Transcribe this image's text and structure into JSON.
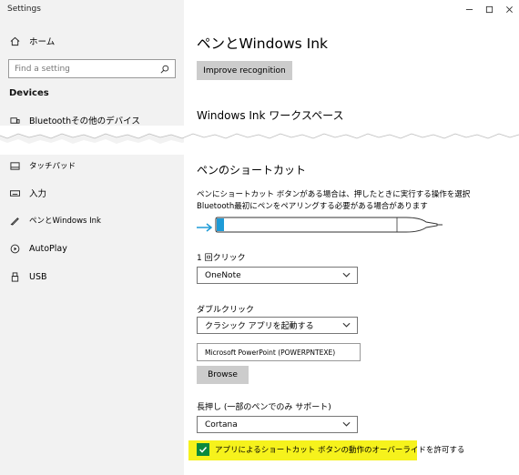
{
  "window": {
    "title": "Settings",
    "accent_color": "#0a8a3d",
    "highlight_color": "#f6f21c"
  },
  "sidebar": {
    "home_label": "ホーム",
    "search_placeholder": "Find a setting",
    "section_label": "Devices",
    "items": [
      {
        "label": "Bluetoothその他のデバイス",
        "icon": "bluetooth-devices-icon"
      },
      {
        "label": "タッチパッド",
        "icon": "touchpad-icon"
      },
      {
        "label": "入力",
        "icon": "keyboard-icon"
      },
      {
        "label": "ペンとWindows Ink",
        "icon": "pen-icon"
      },
      {
        "label": "AutoPlay",
        "icon": "autoplay-icon"
      },
      {
        "label": "USB",
        "icon": "usb-icon"
      }
    ]
  },
  "main": {
    "title": "ペンとWindows Ink",
    "improve_button": "Improve recognition",
    "workspace_heading": "Windows Ink ワークスペース",
    "shortcuts_heading": "ペンのショートカット",
    "description": "ペンにショートカット ボタンがある場合は、押したときに実行する操作を選択Bluetooth最初にペンをペアリングする必要がある場合があります",
    "single_click_label": "1 回クリック",
    "single_click_value": "OneNote",
    "double_click_label": "ダブルクリック",
    "double_click_value": "クラシック アプリを起動する",
    "app_path_value": "Microsoft PowerPoint (POWERPNTEXE)",
    "browse_button": "Browse",
    "long_press_label": "長押し (一部のペンでのみ サポート)",
    "long_press_value": "Cortana",
    "override_checkbox_label": "アプリによるショートカット ボタンの動作のオーバーライドを許可する",
    "override_checked": true
  }
}
